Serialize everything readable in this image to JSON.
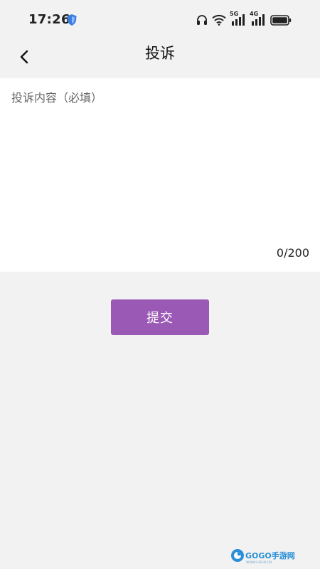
{
  "status_bar": {
    "time": "17:26",
    "network_1": "5G",
    "network_2": "4G"
  },
  "header": {
    "title": "投诉"
  },
  "form": {
    "placeholder": "投诉内容（必填）",
    "value": "",
    "char_count": "0/200"
  },
  "actions": {
    "submit_label": "提交"
  },
  "theme": {
    "accent": "#9b59b6",
    "background": "#f2f2f2",
    "panel": "#ffffff"
  },
  "icons": {
    "back": "chevron-left-icon",
    "headphones": "headphones-icon",
    "wifi": "wifi-icon",
    "signal": "signal-icon",
    "battery": "battery-icon",
    "shield": "shield-icon"
  },
  "watermark": {
    "label": "GOGO手游网",
    "url": "WWW.GOGO.CN"
  }
}
